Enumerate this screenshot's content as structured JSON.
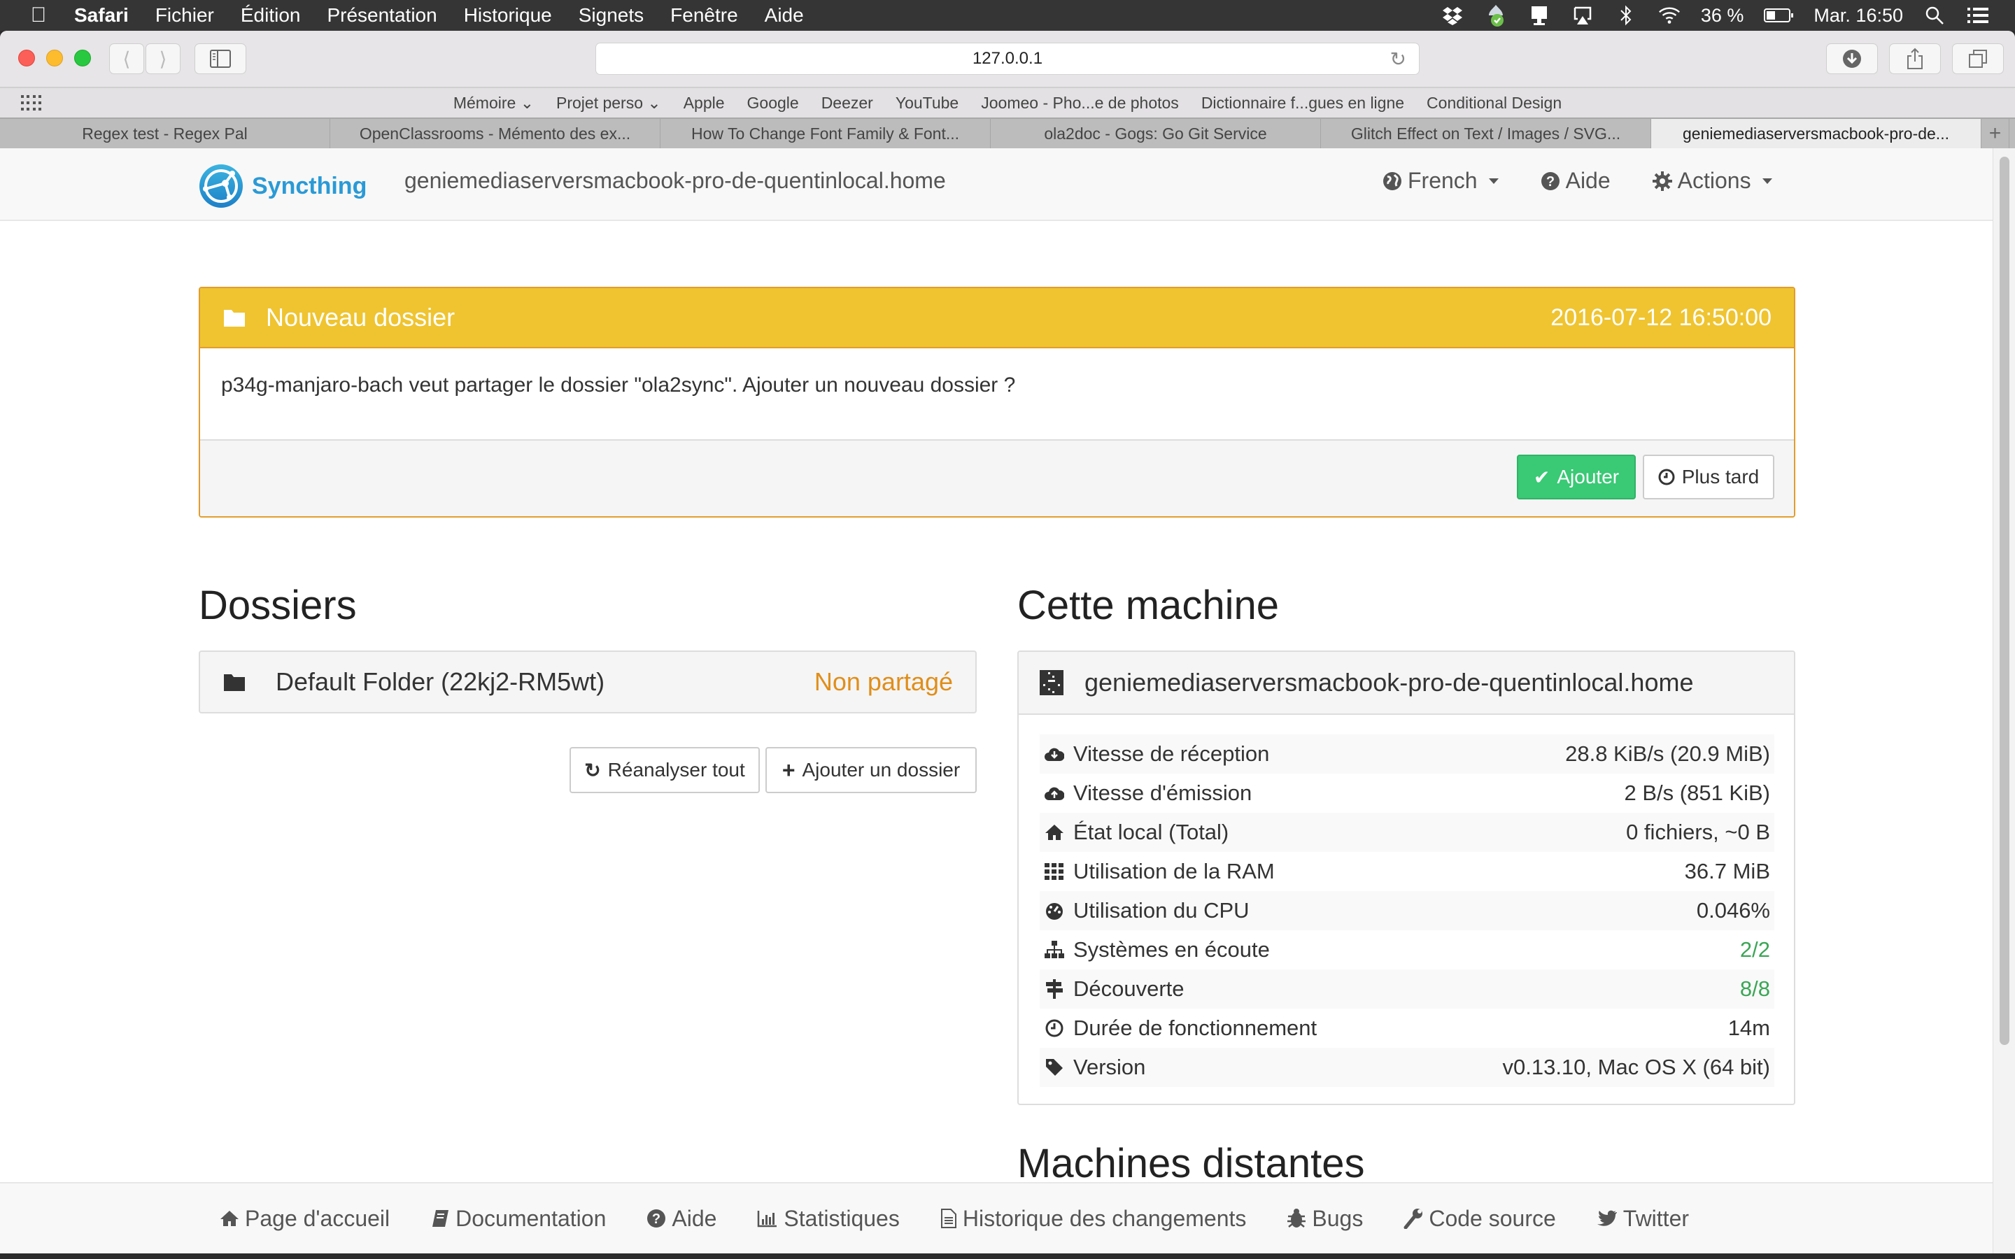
{
  "menubar": {
    "app": "Safari",
    "items": [
      "Fichier",
      "Édition",
      "Présentation",
      "Historique",
      "Signets",
      "Fenêtre",
      "Aide"
    ],
    "battery": "36 %",
    "clock": "Mar. 16:50"
  },
  "browser": {
    "url": "127.0.0.1",
    "bookmarks": [
      "Mémoire",
      "Projet perso",
      "Apple",
      "Google",
      "Deezer",
      "YouTube",
      "Joomeo - Pho...e de photos",
      "Dictionnaire f...gues en ligne",
      "Conditional Design"
    ],
    "tabs": [
      {
        "label": "Regex test - Regex Pal"
      },
      {
        "label": "OpenClassrooms - Mémento des ex..."
      },
      {
        "label": "How To Change Font Family & Font..."
      },
      {
        "label": "ola2doc - Gogs: Go Git Service"
      },
      {
        "label": "Glitch Effect on Text / Images / SVG..."
      },
      {
        "label": "geniemediaserversmacbook-pro-de...",
        "active": true
      }
    ]
  },
  "navbar": {
    "brand": "Syncthing",
    "hostname": "geniemediaserversmacbook-pro-de-quentinlocal.home",
    "language": "French",
    "help": "Aide",
    "actions": "Actions"
  },
  "notice": {
    "title": "Nouveau dossier",
    "timestamp": "2016-07-12 16:50:00",
    "message": "p34g-manjaro-bach veut partager le dossier \"ola2sync\". Ajouter un nouveau dossier ?",
    "add_label": "Ajouter",
    "later_label": "Plus tard"
  },
  "folders": {
    "title": "Dossiers",
    "items": [
      {
        "name": "Default Folder (22kj2-RM5wt)",
        "status": "Non partagé"
      }
    ],
    "rescan_label": "Réanalyser tout",
    "add_label": "Ajouter un dossier"
  },
  "device": {
    "title": "Cette machine",
    "name": "geniemediaserversmacbook-pro-de-quentinlocal.home",
    "rows": [
      {
        "icon": "cloud-download-icon",
        "label": "Vitesse de réception",
        "value": "28.8 KiB/s (20.9 MiB)"
      },
      {
        "icon": "cloud-upload-icon",
        "label": "Vitesse d'émission",
        "value": "2 B/s (851 KiB)"
      },
      {
        "icon": "home-icon",
        "label": "État local (Total)",
        "value": "0 fichiers, ~0 B"
      },
      {
        "icon": "grid-icon",
        "label": "Utilisation de la RAM",
        "value": "36.7 MiB"
      },
      {
        "icon": "dashboard-icon",
        "label": "Utilisation du CPU",
        "value": "0.046%"
      },
      {
        "icon": "sitemap-icon",
        "label": "Systèmes en écoute",
        "value": "2/2",
        "ok": true
      },
      {
        "icon": "signpost-icon",
        "label": "Découverte",
        "value": "8/8",
        "ok": true
      },
      {
        "icon": "clock-icon",
        "label": "Durée de fonctionnement",
        "value": "14m"
      },
      {
        "icon": "tag-icon",
        "label": "Version",
        "value": "v0.13.10, Mac OS X (64 bit)"
      }
    ]
  },
  "remote": {
    "title": "Machines distantes"
  },
  "footer": {
    "links": [
      {
        "icon": "home-icon",
        "label": "Page d'accueil"
      },
      {
        "icon": "book-icon",
        "label": "Documentation"
      },
      {
        "icon": "question-icon",
        "label": "Aide"
      },
      {
        "icon": "bar-chart-icon",
        "label": "Statistiques"
      },
      {
        "icon": "file-icon",
        "label": "Historique des changements"
      },
      {
        "icon": "bug-icon",
        "label": "Bugs"
      },
      {
        "icon": "wrench-icon",
        "label": "Code source"
      },
      {
        "icon": "twitter-icon",
        "label": "Twitter"
      }
    ]
  },
  "colors": {
    "brand": "#2a9ad6",
    "notice": "#efc430",
    "success": "#3ac975",
    "warning_text": "#e08e1a",
    "ok_text": "#3aa655"
  }
}
